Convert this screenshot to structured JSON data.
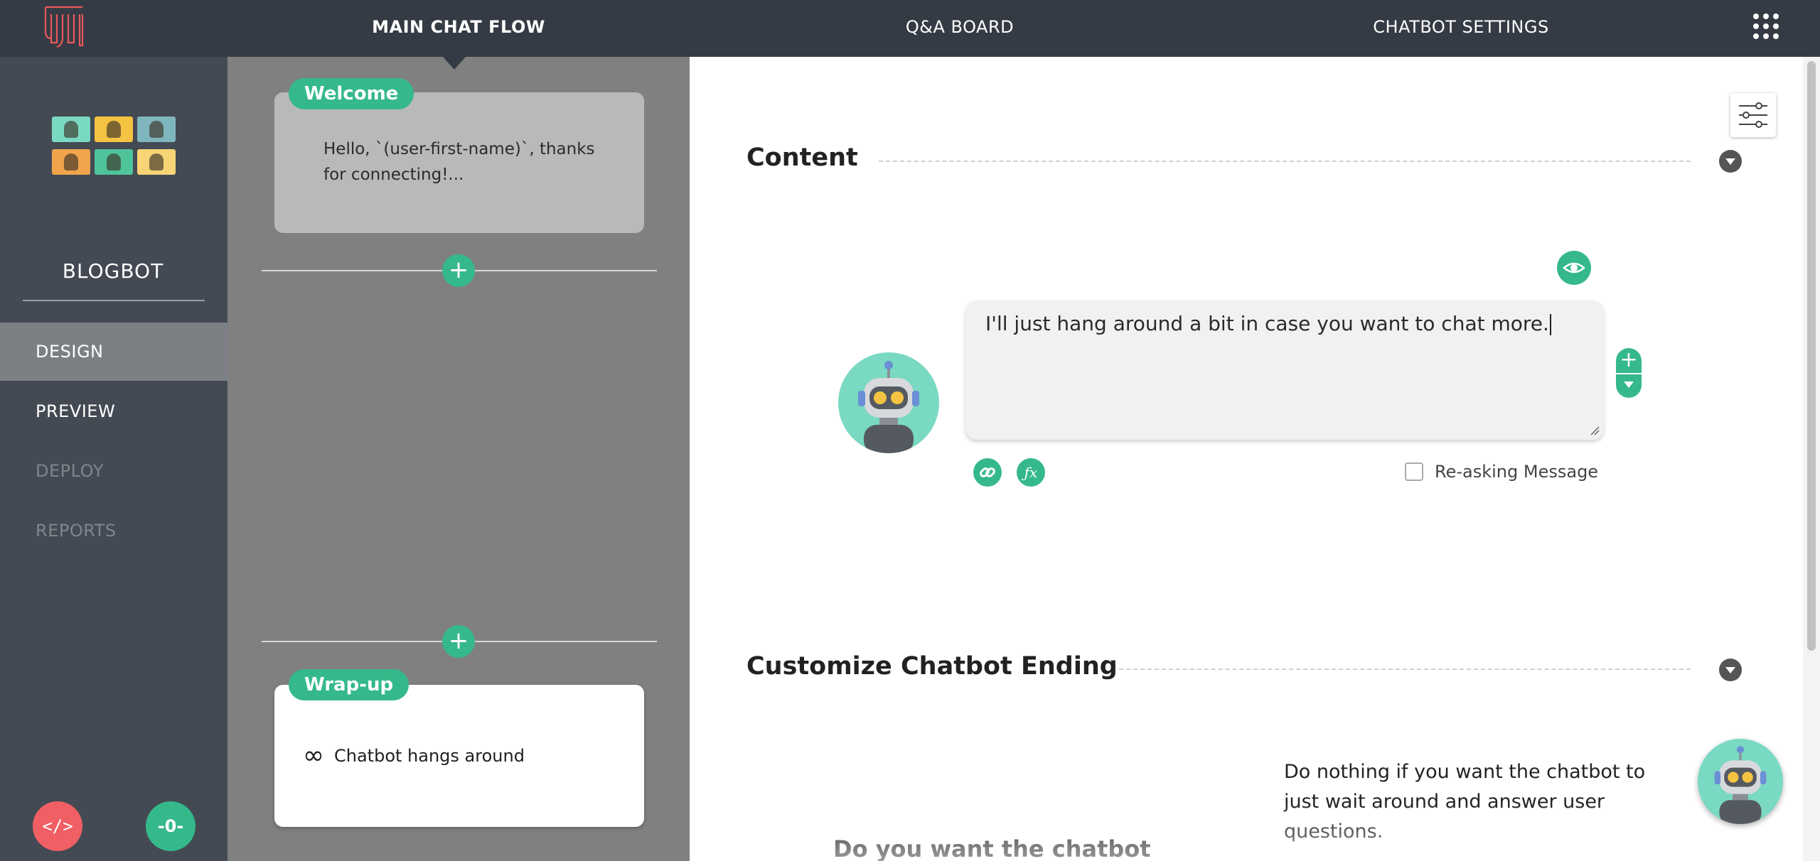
{
  "header": {
    "tabs": [
      {
        "label": "MAIN CHAT FLOW",
        "active": true
      },
      {
        "label": "Q&A BOARD",
        "active": false
      },
      {
        "label": "CHATBOT SETTINGS",
        "active": false
      }
    ],
    "apps_icon": "grid-icon"
  },
  "sidebar": {
    "bot_name": "BLOGBOT",
    "items": [
      {
        "label": "DESIGN",
        "state": "active"
      },
      {
        "label": "PREVIEW",
        "state": "enabled"
      },
      {
        "label": "DEPLOY",
        "state": "disabled"
      },
      {
        "label": "REPORTS",
        "state": "disabled"
      }
    ],
    "code_button": "</>",
    "toggle_button": "-0-"
  },
  "flow": {
    "welcome": {
      "tag": "Welcome",
      "text": "Hello, `(user-first-name)`, thanks for connecting!..."
    },
    "wrapup": {
      "tag": "Wrap-up",
      "text": "Chatbot hangs around"
    }
  },
  "content": {
    "section_title": "Content",
    "message": "I'll just hang around a bit in case you want to chat more.",
    "reasking_label": "Re-asking Message"
  },
  "ending": {
    "section_title": "Customize Chatbot Ending",
    "description": "Do nothing if you want the chatbot to just wait around and answer user questions.",
    "question": "Do you want the chatbot"
  },
  "colors": {
    "topbar": "#353b44",
    "sidebar": "#444a53",
    "flow_background": "#808080",
    "accent_green": "#35b98a",
    "code_button_red": "#ef5f64"
  }
}
